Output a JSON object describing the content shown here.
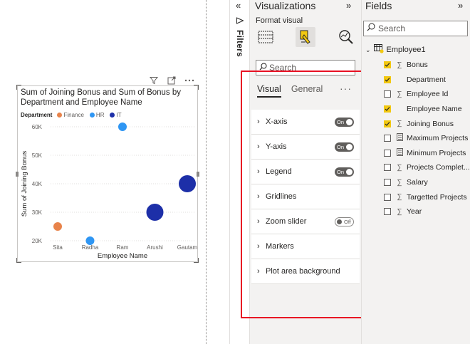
{
  "visual": {
    "title": "Sum of Joining Bonus and Sum of Bonus by Department and Employee Name",
    "legend_title": "Department",
    "legend_entries": [
      {
        "name": "Finance",
        "color": "#e8834a"
      },
      {
        "name": "HR",
        "color": "#2f96f3"
      },
      {
        "name": "IT",
        "color": "#1d2fa8"
      }
    ],
    "header_icons": [
      "filter-icon",
      "focus-mode-icon",
      "more-options-icon"
    ]
  },
  "chart_data": {
    "type": "scatter",
    "title": "Sum of Joining Bonus and Sum of Bonus by Department and Employee Name",
    "xlabel": "Employee Name",
    "ylabel": "Sum of Joining Bonus",
    "categories": [
      "Sita",
      "Radha",
      "Ram",
      "Arushi",
      "Gautam"
    ],
    "y_ticks": [
      "20K",
      "30K",
      "40K",
      "50K",
      "60K"
    ],
    "ylim": [
      20000,
      60000
    ],
    "grid": true,
    "legend_position": "top-left",
    "series": [
      {
        "name": "Finance",
        "color": "#e8834a",
        "points": [
          {
            "x": "Sita",
            "y": 25000,
            "size": "small"
          }
        ]
      },
      {
        "name": "HR",
        "color": "#2f96f3",
        "points": [
          {
            "x": "Radha",
            "y": 20000,
            "size": "small"
          },
          {
            "x": "Ram",
            "y": 60000,
            "size": "small"
          }
        ]
      },
      {
        "name": "IT",
        "color": "#1d2fa8",
        "points": [
          {
            "x": "Arushi",
            "y": 30000,
            "size": "large"
          },
          {
            "x": "Gautam",
            "y": 40000,
            "size": "large"
          }
        ]
      }
    ]
  },
  "filters": {
    "label": "Filters"
  },
  "visualizations": {
    "title": "Visualizations",
    "subtitle": "Format visual",
    "search_placeholder": "Search",
    "tabs": [
      {
        "label": "Visual",
        "active": true
      },
      {
        "label": "General",
        "active": false
      }
    ],
    "more": "···",
    "cards": [
      {
        "label": "X-axis",
        "toggle": "On"
      },
      {
        "label": "Y-axis",
        "toggle": "On"
      },
      {
        "label": "Legend",
        "toggle": "On"
      },
      {
        "label": "Gridlines",
        "toggle": null
      },
      {
        "label": "Zoom slider",
        "toggle": "Off"
      },
      {
        "label": "Markers",
        "toggle": null
      },
      {
        "label": "Plot area background",
        "toggle": null
      }
    ]
  },
  "fields": {
    "title": "Fields",
    "search_placeholder": "Search",
    "table_name": "Employee1",
    "items": [
      {
        "label": "Bonus",
        "checked": true,
        "icon": "sigma"
      },
      {
        "label": "Department",
        "checked": true,
        "icon": "none"
      },
      {
        "label": "Employee Id",
        "checked": false,
        "icon": "sigma"
      },
      {
        "label": "Employee Name",
        "checked": true,
        "icon": "none"
      },
      {
        "label": "Joining Bonus",
        "checked": true,
        "icon": "sigma"
      },
      {
        "label": "Maximum Projects",
        "checked": false,
        "icon": "calc"
      },
      {
        "label": "Minimum Projects",
        "checked": false,
        "icon": "calc"
      },
      {
        "label": "Projects Complet...",
        "checked": false,
        "icon": "sigma"
      },
      {
        "label": "Salary",
        "checked": false,
        "icon": "sigma"
      },
      {
        "label": "Targetted Projects",
        "checked": false,
        "icon": "sigma"
      },
      {
        "label": "Year",
        "checked": false,
        "icon": "sigma"
      }
    ]
  }
}
